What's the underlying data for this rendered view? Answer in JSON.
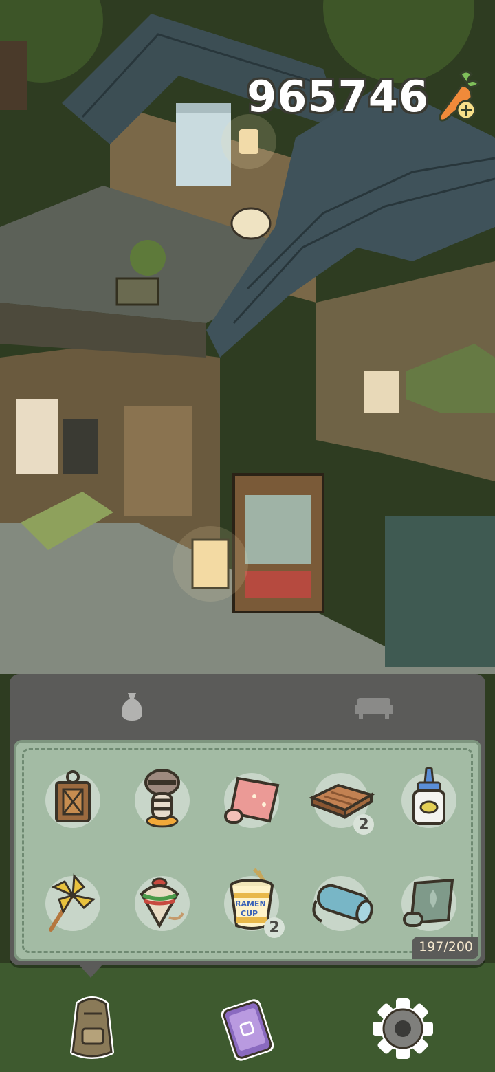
{
  "hud": {
    "carrot_count": "965746"
  },
  "inventory": {
    "tabs": [
      {
        "name": "bag",
        "icon": "bag-icon",
        "active": true
      },
      {
        "name": "furniture",
        "icon": "sofa-icon",
        "active": false
      }
    ],
    "items": [
      {
        "icon": "lantern-icon",
        "count": ""
      },
      {
        "icon": "raccoon-figurine-icon",
        "count": ""
      },
      {
        "icon": "pink-scroll-icon",
        "count": ""
      },
      {
        "icon": "wooden-tray-icon",
        "count": "2"
      },
      {
        "icon": "glue-bottle-icon",
        "count": ""
      },
      {
        "icon": "pinwheel-icon",
        "count": ""
      },
      {
        "icon": "spinning-top-icon",
        "count": ""
      },
      {
        "icon": "ramen-cup-icon",
        "count": "2",
        "label_top": "RAMEN",
        "label_bottom": "CUP"
      },
      {
        "icon": "yoga-mat-icon",
        "count": ""
      },
      {
        "icon": "green-wallpaper-roll-icon",
        "count": ""
      }
    ],
    "capacity": "197/200"
  },
  "bottom_nav": [
    {
      "name": "backpack",
      "icon": "backpack-icon"
    },
    {
      "name": "phone",
      "icon": "phone-icon"
    },
    {
      "name": "settings",
      "icon": "gear-icon"
    }
  ],
  "colors": {
    "panel": "#5b5b59",
    "inventory_bg": "#a3bba4",
    "accent_text": "#f3e6cc"
  }
}
